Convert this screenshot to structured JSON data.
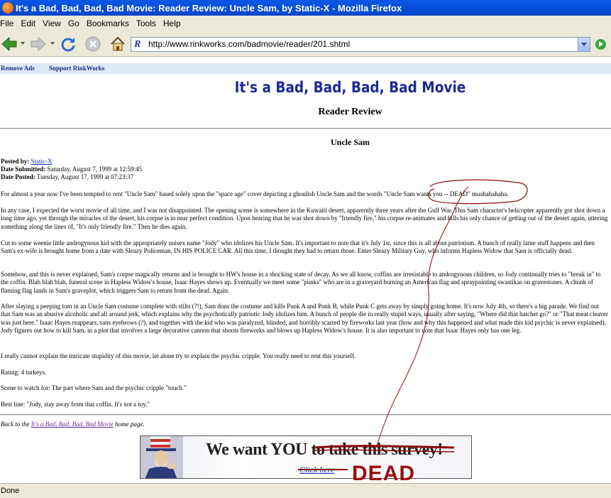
{
  "window": {
    "title": "It's a Bad, Bad, Bad, Bad Movie: Reader Review: Uncle Sam, by Static-X - Mozilla Firefox"
  },
  "menu": [
    "File",
    "Edit",
    "View",
    "Go",
    "Bookmarks",
    "Tools",
    "Help"
  ],
  "toolbar": {
    "back_icon": "back-arrow-icon",
    "forward_icon": "forward-arrow-icon",
    "reload_icon": "reload-icon",
    "stop_icon": "stop-icon",
    "home_icon": "home-icon",
    "go_icon": "go-icon"
  },
  "address": {
    "url": "http://www.rinkworks.com/badmovie/reader/201.shtml"
  },
  "adbar": {
    "remove_ads": "Remove Ads",
    "support": "Support RinkWorks"
  },
  "page": {
    "site_title": "It's a Bad, Bad, Bad, Bad Movie",
    "subtitle": "Reader Review",
    "review_title": "Uncle Sam",
    "meta": {
      "posted_by_label": "Posted by:",
      "posted_by": "Static-X",
      "submitted_label": "Date Submitted:",
      "submitted": "Saturday, August 7, 1999 at 12:59:45",
      "posted_label": "Date Posted:",
      "posted": "Tuesday, August 17, 1999 at 07:23:37"
    },
    "paragraphs": [
      "For almost a year now I've been tempted to rent \"Uncle Sam\" based solely upon the \"space age\" cover depicting a ghoulish Uncle Sam and the words \"Uncle Sam wants you -- DEAD\" muahahahaha.",
      "In any case, I expected the worst movie of all time, and I was not disappointed. The opening scene is somewhere in the Kuwaiti desert, apparently three years after the Gulf War. This Sam character's helicopter apparently got shot down a long time ago, yet through the miracles of the desert, his corpse is in near perfect condition. Upon hearing that he was shot down by \"friendly fire,\" his corpse re-animates and kills his only chance of getting out of the desert again, uttering something along the lines of, \"It's only friendly fire.\" Then he dies again.",
      "Cut to some weenie little androgynous kid with the appropriately unisex name \"Jody\" who idolizes his Uncle Sam. It's important to note that it's July 1st, since this is all about patriotism. A bunch of really lame stuff happens and then Sam's ex-wife is brought home from a date with Sleazy Policeman, IN HIS POLICE CAR. All this time, I thought they had to return those. Enter Sleazy Military Guy, who informs Hapless Widow that Sam is officially dead.",
      "Somehow, and this is never explained, Sam's corpse magically returns and is brought to HW's house in a shocking state of decay. As we all know, coffins are irresistable to androgynous children, so Jody continually tries to \"break in\" to the coffin. Blah blah blah, funeral scene in Hapless Widow's house, Isaac Hayes shows up. Eventually we meet some \"punks\" who are in a graveyard burning an American flag and spraypainting swastikas on gravestones. A chunk of flaming flag lands in Sam's graveplot, which triggers Sam to return from the dead. Again.",
      "After slaying a peeping tom in an Uncle Sam costume complete with stilts (?!), Sam dons the costume and kills Punk A and Punk B, while Punk C gets away by simply going home. It's now July 4th, so there's a big parade. We find out that Sam was an abusive alcoholic and all around jerk, which explains why the psychotically patriotic Jody idolizes him. A bunch of people die in really stupid ways, usually after saying, \"Where did that hatchet go?\" or \"That meat cleaver was just here.\" Isaac Hayes reappears, sans eyebrows (?), and together with the kid who was paralyzed, blinded, and horribly scarred by fireworks last year (how and why this happened and what made this kid psychic is never explained). Jody figures out how to kill Sam, in a plot that involves a large decorative cannon that shoots fireworks and blows up Hapless Widow's house. It is also important to note that Isaac Hayes only has one leg.",
      "I really cannot explain the intricate stupidity of this movie, let alone try to explain the psychic cripple. You really need to rent this yourself.",
      "Rating: 4 turkeys.",
      "Scene to watch for: The part where Sam and the psychic cripple \"touch.\"",
      "Best line: \"Jody, stay away from that coffin. It's not a toy.\""
    ],
    "back": {
      "prefix": "Back to the ",
      "link": "It's a Bad, Bad, Bad, Bad Movie",
      "suffix": " home page."
    }
  },
  "banner": {
    "text_main": "We want YOU ",
    "text_struck": "to take this survey!",
    "click": "Click here",
    "scrawl": "DEAD"
  },
  "status": "Done",
  "colors": {
    "titlebar": "#0345c8",
    "chrome": "#ece9d8",
    "site_title": "#1c2a96",
    "link": "#1a2cb8",
    "scribble": "#8b0a0a"
  }
}
